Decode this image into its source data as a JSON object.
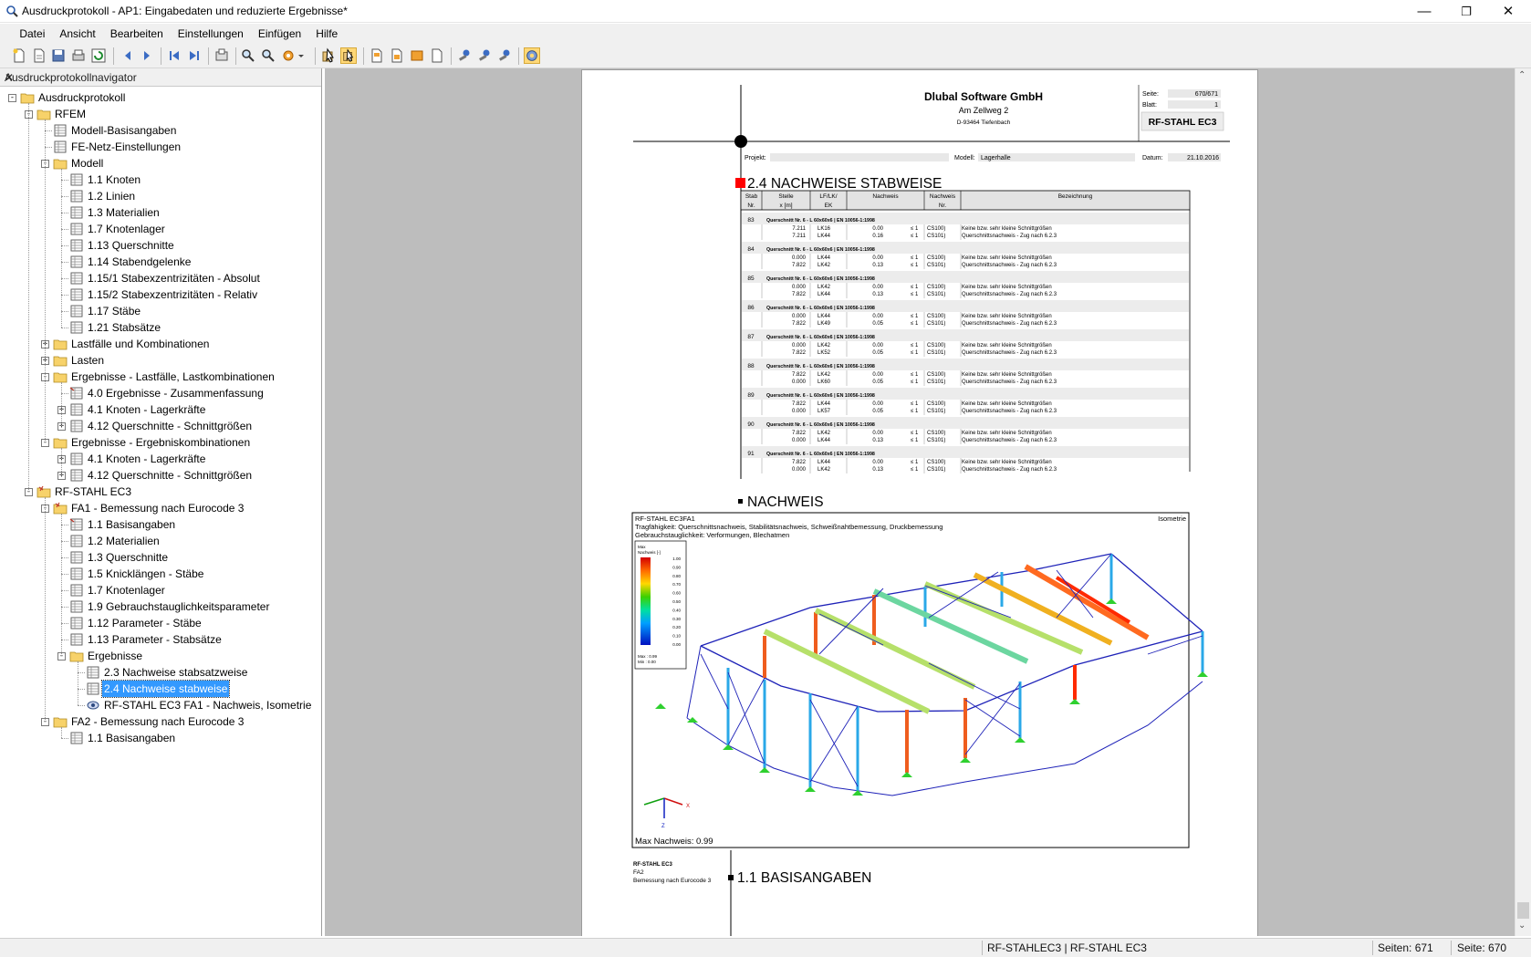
{
  "window": {
    "title": "Ausdruckprotokoll - AP1: Eingabedaten und reduzierte Ergebnisse*"
  },
  "menu": [
    "Datei",
    "Ansicht",
    "Bearbeiten",
    "Einstellungen",
    "Einfügen",
    "Hilfe"
  ],
  "navigator": {
    "title": "Ausdruckprotokollnavigator",
    "items": [
      {
        "label": "Ausdruckprotokoll",
        "level": 0,
        "icon": "folder-icon",
        "expander": "-"
      },
      {
        "label": "RFEM",
        "level": 1,
        "icon": "folder-icon",
        "expander": "-"
      },
      {
        "label": "Modell-Basisangaben",
        "level": 2,
        "icon": "table-icon",
        "expander": ""
      },
      {
        "label": "FE-Netz-Einstellungen",
        "level": 2,
        "icon": "table-icon",
        "expander": ""
      },
      {
        "label": "Modell",
        "level": 2,
        "icon": "folder-icon",
        "expander": "-"
      },
      {
        "label": "1.1 Knoten",
        "level": 3,
        "icon": "table-icon",
        "expander": ""
      },
      {
        "label": "1.2 Linien",
        "level": 3,
        "icon": "table-icon",
        "expander": ""
      },
      {
        "label": "1.3 Materialien",
        "level": 3,
        "icon": "table-icon",
        "expander": ""
      },
      {
        "label": "1.7 Knotenlager",
        "level": 3,
        "icon": "table-icon",
        "expander": ""
      },
      {
        "label": "1.13 Querschnitte",
        "level": 3,
        "icon": "table-icon",
        "expander": ""
      },
      {
        "label": "1.14 Stabendgelenke",
        "level": 3,
        "icon": "table-icon",
        "expander": ""
      },
      {
        "label": "1.15/1 Stabexzentrizitäten - Absolut",
        "level": 3,
        "icon": "table-icon",
        "expander": ""
      },
      {
        "label": "1.15/2 Stabexzentrizitäten - Relativ",
        "level": 3,
        "icon": "table-icon",
        "expander": ""
      },
      {
        "label": "1.17 Stäbe",
        "level": 3,
        "icon": "table-icon",
        "expander": ""
      },
      {
        "label": "1.21 Stabsätze",
        "level": 3,
        "icon": "table-icon",
        "expander": ""
      },
      {
        "label": "Lastfälle und Kombinationen",
        "level": 2,
        "icon": "folder-icon",
        "expander": "+"
      },
      {
        "label": "Lasten",
        "level": 2,
        "icon": "folder-icon",
        "expander": "+"
      },
      {
        "label": "Ergebnisse - Lastfälle, Lastkombinationen",
        "level": 2,
        "icon": "folder-icon",
        "expander": "-"
      },
      {
        "label": "4.0 Ergebnisse - Zusammenfassung",
        "level": 3,
        "icon": "result-table-icon",
        "expander": ""
      },
      {
        "label": "4.1 Knoten - Lagerkräfte",
        "level": 3,
        "icon": "table-icon",
        "expander": "+"
      },
      {
        "label": "4.12 Querschnitte - Schnittgrößen",
        "level": 3,
        "icon": "table-icon",
        "expander": "+"
      },
      {
        "label": "Ergebnisse - Ergebniskombinationen",
        "level": 2,
        "icon": "folder-icon",
        "expander": "-"
      },
      {
        "label": "4.1 Knoten - Lagerkräfte",
        "level": 3,
        "icon": "table-icon",
        "expander": "+"
      },
      {
        "label": "4.12 Querschnitte - Schnittgrößen",
        "level": 3,
        "icon": "table-icon",
        "expander": "+"
      },
      {
        "label": "RF-STAHL EC3",
        "level": 1,
        "icon": "module-folder-icon",
        "expander": "-"
      },
      {
        "label": "FA1 - Bemessung nach Eurocode 3",
        "level": 2,
        "icon": "module-folder-icon",
        "expander": "-"
      },
      {
        "label": "1.1 Basisangaben",
        "level": 3,
        "icon": "result-table-icon",
        "expander": ""
      },
      {
        "label": "1.2 Materialien",
        "level": 3,
        "icon": "table-icon",
        "expander": ""
      },
      {
        "label": "1.3 Querschnitte",
        "level": 3,
        "icon": "table-icon",
        "expander": ""
      },
      {
        "label": "1.5 Knicklängen - Stäbe",
        "level": 3,
        "icon": "table-icon",
        "expander": ""
      },
      {
        "label": "1.7 Knotenlager",
        "level": 3,
        "icon": "table-icon",
        "expander": ""
      },
      {
        "label": "1.9 Gebrauchstauglichkeitsparameter",
        "level": 3,
        "icon": "table-icon",
        "expander": ""
      },
      {
        "label": "1.12 Parameter - Stäbe",
        "level": 3,
        "icon": "table-icon",
        "expander": ""
      },
      {
        "label": "1.13 Parameter - Stabsätze",
        "level": 3,
        "icon": "table-icon",
        "expander": ""
      },
      {
        "label": "Ergebnisse",
        "level": 3,
        "icon": "folder-icon",
        "expander": "-"
      },
      {
        "label": "2.3 Nachweise stabsatzweise",
        "level": 4,
        "icon": "table-icon",
        "expander": ""
      },
      {
        "label": "2.4 Nachweise stabweise",
        "level": 4,
        "icon": "table-icon",
        "expander": "",
        "selected": true
      },
      {
        "label": "RF-STAHL EC3 FA1 - Nachweis, Isometrie",
        "level": 4,
        "icon": "eye-icon",
        "expander": ""
      },
      {
        "label": "FA2 - Bemessung nach Eurocode 3",
        "level": 2,
        "icon": "folder-icon",
        "expander": "-"
      },
      {
        "label": "1.1 Basisangaben",
        "level": 3,
        "icon": "table-icon",
        "expander": ""
      }
    ]
  },
  "page": {
    "company": "Dlubal Software GmbH",
    "street": "Am Zellweg 2",
    "city": "D-93464 Tiefenbach",
    "seite_label": "Seite:",
    "seite_value": "670/671",
    "blatt_label": "Blatt:",
    "blatt_value": "1",
    "module_box": "RF-STAHL EC3",
    "projekt_label": "Projekt:",
    "modell_label": "Modell:",
    "modell_value": "Lagerhalle",
    "datum_label": "Datum:",
    "datum_value": "21.10.2016",
    "section_title": "2.4 NACHWEISE STABWEISE",
    "columns": [
      {
        "l1": "Stab",
        "l2": "Nr."
      },
      {
        "l1": "Stelle",
        "l2": "x [m]"
      },
      {
        "l1": "LF/LK/",
        "l2": "EK"
      },
      {
        "l1": "Nachweis",
        "l2": ""
      },
      {
        "l1": "Nachweis",
        "l2": "Nr."
      },
      {
        "l1": "Bezeichnung",
        "l2": ""
      }
    ],
    "rows": [
      {
        "stab": "83",
        "qs": "Querschnitt Nr. 6 - L 60x60x6 | EN 10056-1:1998",
        "lines": [
          [
            "7.211",
            "LK16",
            "0.00",
            "≤ 1",
            "CS100)",
            "Keine bzw. sehr kleine Schnittgrößen"
          ],
          [
            "7.211",
            "LK44",
            "0.16",
            "≤ 1",
            "CS101)",
            "Querschnittsnachweis - Zug nach 6.2.3"
          ]
        ]
      },
      {
        "stab": "84",
        "qs": "Querschnitt Nr. 6 - L 60x60x6 | EN 10056-1:1998",
        "lines": [
          [
            "0.000",
            "LK44",
            "0.00",
            "≤ 1",
            "CS100)",
            "Keine bzw. sehr kleine Schnittgrößen"
          ],
          [
            "7.822",
            "LK42",
            "0.13",
            "≤ 1",
            "CS101)",
            "Querschnittsnachweis - Zug nach 6.2.3"
          ]
        ]
      },
      {
        "stab": "85",
        "qs": "Querschnitt Nr. 6 - L 60x60x6 | EN 10056-1:1998",
        "lines": [
          [
            "0.000",
            "LK42",
            "0.00",
            "≤ 1",
            "CS100)",
            "Keine bzw. sehr kleine Schnittgrößen"
          ],
          [
            "7.822",
            "LK44",
            "0.13",
            "≤ 1",
            "CS101)",
            "Querschnittsnachweis - Zug nach 6.2.3"
          ]
        ]
      },
      {
        "stab": "86",
        "qs": "Querschnitt Nr. 6 - L 60x60x6 | EN 10056-1:1998",
        "lines": [
          [
            "0.000",
            "LK44",
            "0.00",
            "≤ 1",
            "CS100)",
            "Keine bzw. sehr kleine Schnittgrößen"
          ],
          [
            "7.822",
            "LK49",
            "0.05",
            "≤ 1",
            "CS101)",
            "Querschnittsnachweis - Zug nach 6.2.3"
          ]
        ]
      },
      {
        "stab": "87",
        "qs": "Querschnitt Nr. 6 - L 60x60x6 | EN 10056-1:1998",
        "lines": [
          [
            "0.000",
            "LK42",
            "0.00",
            "≤ 1",
            "CS100)",
            "Keine bzw. sehr kleine Schnittgrößen"
          ],
          [
            "7.822",
            "LK52",
            "0.05",
            "≤ 1",
            "CS101)",
            "Querschnittsnachweis - Zug nach 6.2.3"
          ]
        ]
      },
      {
        "stab": "88",
        "qs": "Querschnitt Nr. 6 - L 60x60x6 | EN 10056-1:1998",
        "lines": [
          [
            "7.822",
            "LK42",
            "0.00",
            "≤ 1",
            "CS100)",
            "Keine bzw. sehr kleine Schnittgrößen"
          ],
          [
            "0.000",
            "LK60",
            "0.05",
            "≤ 1",
            "CS101)",
            "Querschnittsnachweis - Zug nach 6.2.3"
          ]
        ]
      },
      {
        "stab": "89",
        "qs": "Querschnitt Nr. 6 - L 60x60x6 | EN 10056-1:1998",
        "lines": [
          [
            "7.822",
            "LK44",
            "0.00",
            "≤ 1",
            "CS100)",
            "Keine bzw. sehr kleine Schnittgrößen"
          ],
          [
            "0.000",
            "LK57",
            "0.05",
            "≤ 1",
            "CS101)",
            "Querschnittsnachweis - Zug nach 6.2.3"
          ]
        ]
      },
      {
        "stab": "90",
        "qs": "Querschnitt Nr. 6 - L 60x60x6 | EN 10056-1:1998",
        "lines": [
          [
            "7.822",
            "LK42",
            "0.00",
            "≤ 1",
            "CS100)",
            "Keine bzw. sehr kleine Schnittgrößen"
          ],
          [
            "0.000",
            "LK44",
            "0.13",
            "≤ 1",
            "CS101)",
            "Querschnittsnachweis - Zug nach 6.2.3"
          ]
        ]
      },
      {
        "stab": "91",
        "qs": "Querschnitt Nr. 6 - L 60x60x6 | EN 10056-1:1998",
        "lines": [
          [
            "7.822",
            "LK44",
            "0.00",
            "≤ 1",
            "CS100)",
            "Keine bzw. sehr kleine Schnittgrößen"
          ],
          [
            "0.000",
            "LK42",
            "0.13",
            "≤ 1",
            "CS101)",
            "Querschnittsnachweis - Zug nach 6.2.3"
          ]
        ]
      }
    ],
    "nachweis_title": "NACHWEIS",
    "graphic": {
      "title": "RF-STAHL EC3FA1",
      "line2": "Tragfähigkeit: Querschnittsnachweis, Stabilitätsnachweis, Schweißnahtbemessung, Druckbemessung",
      "line3": "Gebrauchstauglichkeit: Verformungen, Blechatmen",
      "view": "Isometrie",
      "legend_title": "Max",
      "legend_sub": "Nachweis [-]",
      "legend_values": [
        "1.00",
        "0.90",
        "0.80",
        "0.70",
        "0.60",
        "0.50",
        "0.40",
        "0.30",
        "0.20",
        "0.10",
        "0.00"
      ],
      "legend_max": "Max : 0.99",
      "legend_min": "Min : 0.00",
      "max_text": "Max Nachweis: 0.99",
      "axis_x": "X",
      "axis_z": "Z"
    },
    "footer_module": "RF-STAHL EC3",
    "footer_case": "FA2",
    "footer_desc": "Bemessung nach Eurocode 3",
    "next_title": "1.1 BASISANGABEN"
  },
  "status": {
    "module": "RF-STAHLEC3 | RF-STAHL EC3",
    "pages": "Seiten: 671",
    "page": "Seite: 670"
  },
  "colors": {
    "selection": "#3399ff",
    "preview_bg": "#bdbdbd",
    "section_marker": "#ff0000"
  }
}
